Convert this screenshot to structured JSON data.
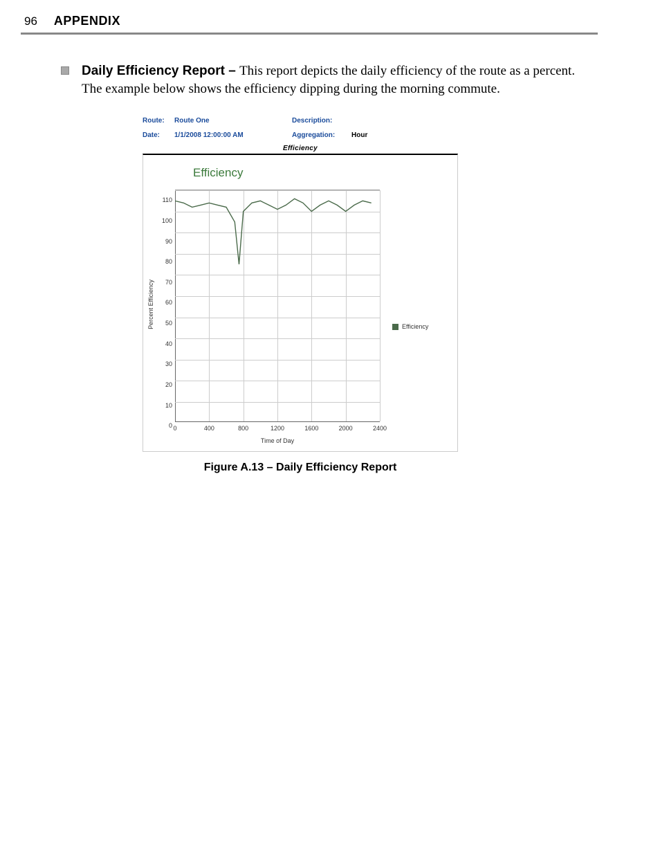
{
  "header": {
    "page_number": "96",
    "section": "APPENDIX"
  },
  "body": {
    "bullet_lead": "Daily Efficiency Report – ",
    "bullet_text": "This report depicts the daily efficiency of the route as a percent. The example below shows the efficiency dipping during the morning commute."
  },
  "report": {
    "route_label": "Route:",
    "route_value": "Route One",
    "description_label": "Description:",
    "description_value": "",
    "date_label": "Date:",
    "date_value": "1/1/2008 12:00:00 AM",
    "aggregation_label": "Aggregation:",
    "aggregation_value": "Hour",
    "chart_header": "Efficiency"
  },
  "chart": {
    "title": "Efficiency",
    "y_axis_label": "Percent Efficiency",
    "x_axis_label": "Time of Day",
    "legend_label": "Efficiency"
  },
  "caption": "Figure A.13 – Daily Efficiency Report",
  "chart_data": {
    "type": "line",
    "title": "Efficiency",
    "xlabel": "Time of Day",
    "ylabel": "Percent Efficiency",
    "xlim": [
      0,
      2400
    ],
    "ylim": [
      0,
      110
    ],
    "x_ticks": [
      0,
      400,
      800,
      1200,
      1600,
      2000,
      2400
    ],
    "y_ticks": [
      0,
      10,
      20,
      30,
      40,
      50,
      60,
      70,
      80,
      90,
      100,
      110
    ],
    "series": [
      {
        "name": "Efficiency",
        "color": "#4a6a4a",
        "x": [
          0,
          100,
          200,
          300,
          400,
          500,
          600,
          700,
          750,
          800,
          900,
          1000,
          1100,
          1200,
          1300,
          1400,
          1500,
          1600,
          1700,
          1800,
          1900,
          2000,
          2100,
          2200,
          2300
        ],
        "values": [
          105,
          104,
          102,
          103,
          104,
          103,
          102,
          95,
          75,
          100,
          104,
          105,
          103,
          101,
          103,
          106,
          104,
          100,
          103,
          105,
          103,
          100,
          103,
          105,
          104
        ]
      }
    ]
  }
}
